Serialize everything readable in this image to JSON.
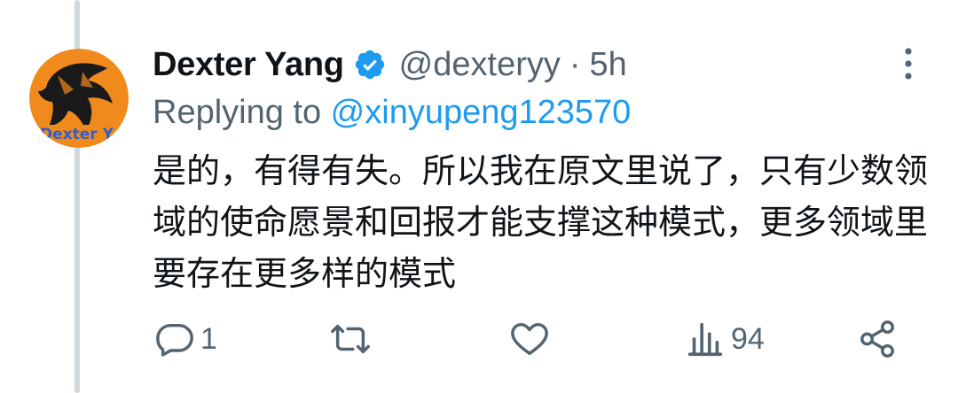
{
  "tweet": {
    "author": {
      "display_name": "Dexter Yang",
      "handle": "@dexteryy",
      "verified": true,
      "avatar_text": "Dexter Y"
    },
    "separator": "·",
    "time": "5h",
    "replying_prefix": "Replying to ",
    "replying_to": "@xinyupeng123570",
    "body": "是的，有得有失。所以我在原文里说了，只有少数领域的使命愿景和回报才能支撑这种模式，更多领域里要存在更多样的模式"
  },
  "actions": {
    "reply_count": "1",
    "retweet_count": "",
    "like_count": "",
    "views_count": "94"
  },
  "colors": {
    "text_primary": "#0f1419",
    "text_secondary": "#536471",
    "accent": "#1d9bf0",
    "avatar_bg": "#f08a1c"
  }
}
